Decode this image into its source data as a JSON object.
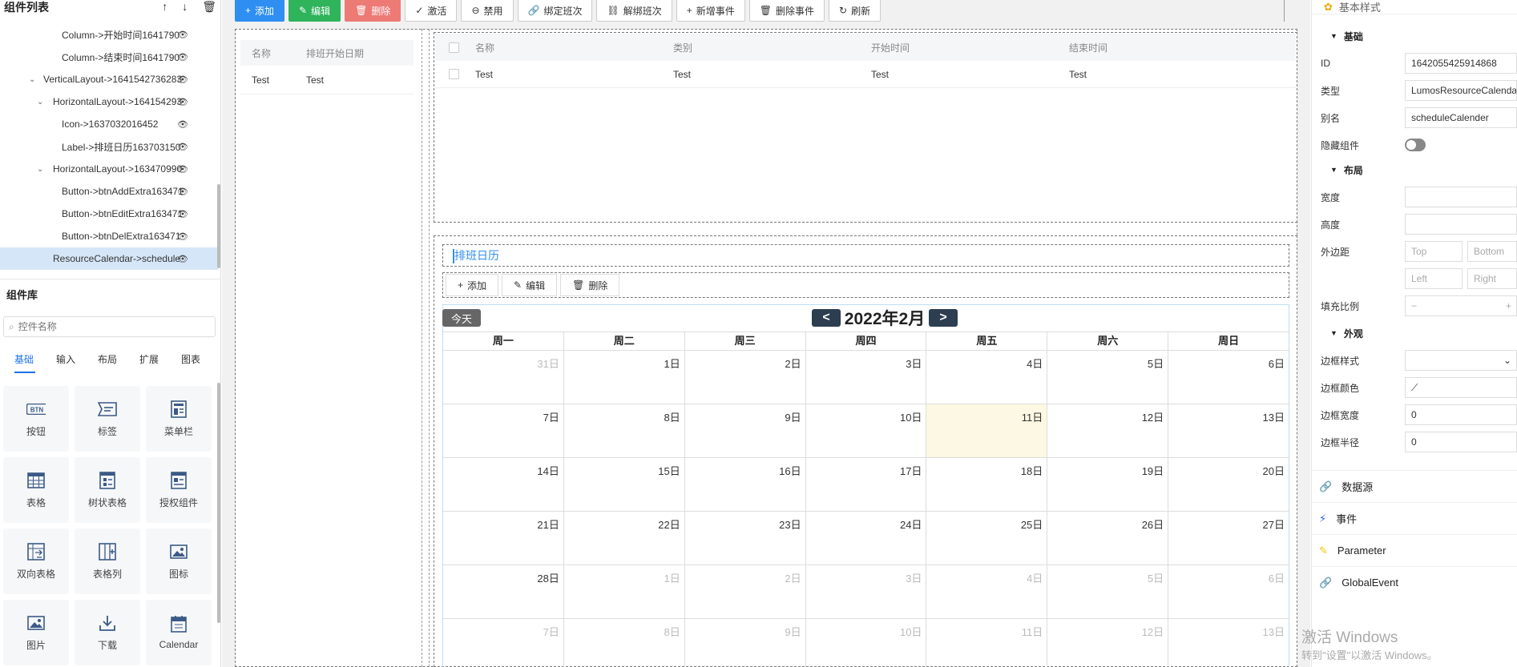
{
  "tree": {
    "title": "组件列表",
    "nodes": [
      {
        "label": "Column->开始时间1641790",
        "indent": 77,
        "chev": ""
      },
      {
        "label": "Column->结束时间1641790",
        "indent": 77,
        "chev": ""
      },
      {
        "label": "VerticalLayout->1641542736283",
        "indent": 54,
        "chev": "⌄"
      },
      {
        "label": "HorizontalLayout->164154293",
        "indent": 66,
        "chev": "⌄"
      },
      {
        "label": "Icon->1637032016452",
        "indent": 77,
        "chev": ""
      },
      {
        "label": "Label->排班日历163703150",
        "indent": 77,
        "chev": ""
      },
      {
        "label": "HorizontalLayout->163470990",
        "indent": 66,
        "chev": "⌄"
      },
      {
        "label": "Button->btnAddExtra163471",
        "indent": 77,
        "chev": ""
      },
      {
        "label": "Button->btnEditExtra163471",
        "indent": 77,
        "chev": ""
      },
      {
        "label": "Button->btnDelExtra163471",
        "indent": 77,
        "chev": ""
      },
      {
        "label": "ResourceCalendar->schedule",
        "indent": 66,
        "chev": "",
        "selected": true
      }
    ]
  },
  "library": {
    "title": "组件库",
    "search_placeholder": "控件名称",
    "tabs": [
      "基础",
      "输入",
      "布局",
      "扩展",
      "图表"
    ],
    "active_tab": 0,
    "components": [
      {
        "label": "按钮",
        "icon": "btn-icon"
      },
      {
        "label": "标签",
        "icon": "tag-icon"
      },
      {
        "label": "菜单栏",
        "icon": "menu-icon"
      },
      {
        "label": "表格",
        "icon": "table-icon"
      },
      {
        "label": "树状表格",
        "icon": "tree-table-icon"
      },
      {
        "label": "授权组件",
        "icon": "auth-icon"
      },
      {
        "label": "双向表格",
        "icon": "bidirectional-table-icon"
      },
      {
        "label": "表格列",
        "icon": "table-column-icon"
      },
      {
        "label": "图标",
        "icon": "image-icon"
      },
      {
        "label": "图片",
        "icon": "picture-icon"
      },
      {
        "label": "下载",
        "icon": "download-icon"
      },
      {
        "label": "Calendar",
        "icon": "calendar-icon"
      }
    ]
  },
  "toolbar": [
    {
      "label": "添加",
      "icon": "+",
      "style": "blue"
    },
    {
      "label": "编辑",
      "icon": "✎",
      "style": "green"
    },
    {
      "label": "删除",
      "icon": "🗑",
      "style": "red"
    },
    {
      "label": "激活",
      "icon": "✓",
      "style": ""
    },
    {
      "label": "禁用",
      "icon": "⊖",
      "style": ""
    },
    {
      "label": "绑定班次",
      "icon": "🔗",
      "style": ""
    },
    {
      "label": "解绑班次",
      "icon": "⛓",
      "style": ""
    },
    {
      "label": "新增事件",
      "icon": "+",
      "style": ""
    },
    {
      "label": "删除事件",
      "icon": "🗑",
      "style": ""
    },
    {
      "label": "刷新",
      "icon": "↻",
      "style": ""
    }
  ],
  "mini_table": {
    "headers": [
      "名称",
      "排班开始日期"
    ],
    "row": [
      "Test",
      "Test"
    ]
  },
  "grid": {
    "headers": [
      "名称",
      "类别",
      "开始时间",
      "结束时间"
    ],
    "row": [
      "Test",
      "Test",
      "Test",
      "Test"
    ]
  },
  "calendar": {
    "title": "排班日历",
    "tools": [
      {
        "label": "添加",
        "icon": "+"
      },
      {
        "label": "编辑",
        "icon": "✎"
      },
      {
        "label": "删除",
        "icon": "🗑"
      }
    ],
    "today": "今天",
    "prev": "<",
    "next": ">",
    "month": "2022年2月",
    "dow": [
      "周一",
      "周二",
      "周三",
      "周四",
      "周五",
      "周六",
      "周日"
    ],
    "weeks": [
      [
        "31日",
        "1日",
        "2日",
        "3日",
        "4日",
        "5日",
        "6日"
      ],
      [
        "7日",
        "8日",
        "9日",
        "10日",
        "11日",
        "12日",
        "13日"
      ],
      [
        "14日",
        "15日",
        "16日",
        "17日",
        "18日",
        "19日",
        "20日"
      ],
      [
        "21日",
        "22日",
        "23日",
        "24日",
        "25日",
        "26日",
        "27日"
      ],
      [
        "28日",
        "1日",
        "2日",
        "3日",
        "4日",
        "5日",
        "6日"
      ],
      [
        "7日",
        "8日",
        "9日",
        "10日",
        "11日",
        "12日",
        "13日"
      ]
    ],
    "other_month": [
      [
        0
      ],
      [],
      [],
      [],
      [
        1,
        2,
        3,
        4,
        5,
        6
      ],
      [
        0,
        1,
        2,
        3,
        4,
        5,
        6
      ]
    ],
    "today_cell": [
      1,
      4
    ]
  },
  "props": {
    "top_title": "基本样式",
    "basic": {
      "title": "基础",
      "id_label": "ID",
      "id_value": "1642055425914868",
      "type_label": "类型",
      "type_value": "LumosResourceCalenda",
      "alias_label": "别名",
      "alias_value": "scheduleCalender",
      "hide_label": "隐藏组件"
    },
    "layout": {
      "title": "布局",
      "width_label": "宽度",
      "height_label": "高度",
      "margin_label": "外边距",
      "top": "Top",
      "bottom": "Bottom",
      "left": "Left",
      "right": "Right",
      "flex_label": "填充比例",
      "minus": "−",
      "plus": "+"
    },
    "appearance": {
      "title": "外观",
      "border_style_label": "边框样式",
      "border_color_label": "边框颜色",
      "border_width_label": "边框宽度",
      "border_width_value": "0",
      "border_radius_label": "边框半径",
      "border_radius_value": "0"
    },
    "accordions": [
      {
        "label": "数据源",
        "icon": "🔗",
        "color": "#2fb35b"
      },
      {
        "label": "事件",
        "icon": "⚡",
        "color": "#2e5be8"
      },
      {
        "label": "Parameter",
        "icon": "✎",
        "color": "#f2c500"
      },
      {
        "label": "GlobalEvent",
        "icon": "🔗",
        "color": "#b03fb0"
      }
    ]
  },
  "watermark": {
    "line1": "激活 Windows",
    "line2": "转到\"设置\"以激活 Windows。"
  }
}
